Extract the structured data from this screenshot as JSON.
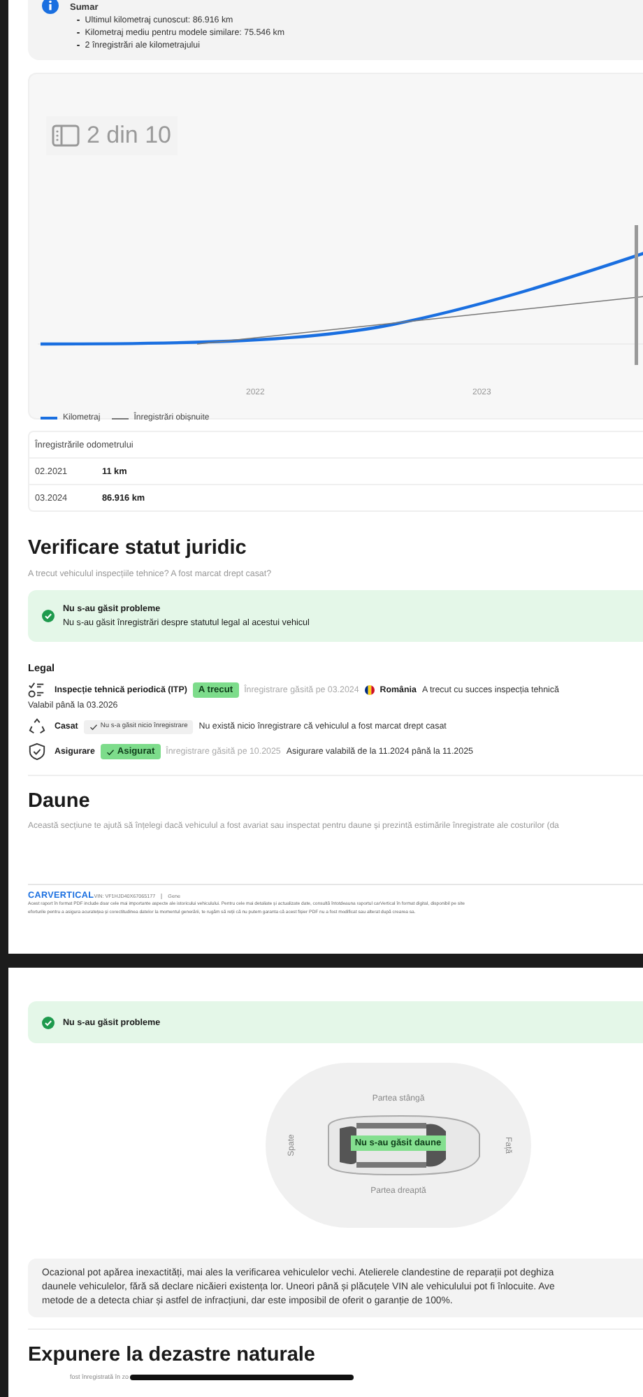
{
  "summary": {
    "title": "Sumar",
    "items": [
      "Ultimul kilometraj cunoscut: 86.916 km",
      "Kilometraj mediu pentru modele similare: 75.546 km",
      "2 înregistrări ale kilometrajului"
    ]
  },
  "mileage_chart": {
    "gallery_counter": "2 din 10",
    "xticks": [
      "2022",
      "2023"
    ],
    "legend": [
      {
        "label": "Kilometraj",
        "color": "#1a6fe0"
      },
      {
        "label": "Înregistrări obișnuite",
        "color": "#777777"
      }
    ]
  },
  "odometer": {
    "title": "Înregistrările odometrului",
    "rows": [
      {
        "date": "02.2021",
        "value": "11 km"
      },
      {
        "date": "03.2024",
        "value": "86.916 km"
      }
    ]
  },
  "legal_status": {
    "title": "Verificare statut juridic",
    "subtitle": "A trecut vehiculul inspecțiile tehnice? A fost marcat drept casat?",
    "alert": {
      "kind": "success",
      "title": "Nu s-au găsit probleme",
      "text": "Nu s-au găsit înregistrări despre statutul legal al acestui vehicul"
    },
    "section": "Legal",
    "records": [
      {
        "kind": "inspection",
        "label": "Inspecție tehnică periodică (ITP)",
        "badge": "A trecut",
        "color": "#7ddc8b",
        "checkmark": false,
        "found": "Înregistrare găsită pe 03.2024",
        "country": "România",
        "note": "A trecut cu succes inspecția tehnică",
        "validity": "Valabil până la 03.2026"
      },
      {
        "kind": "scrapped",
        "label": "Casat",
        "badge": "Nu s-a găsit nicio înregistrare",
        "color": "#f0f0f0",
        "checkmark": true,
        "note": "Nu există nicio înregistrare că vehiculul a fost marcat drept casat"
      },
      {
        "kind": "insurance",
        "label": "Asigurare",
        "badge": "Asigurat",
        "color": "#7ddc8b",
        "checkmark": true,
        "found": "Înregistrare găsită pe 10.2025",
        "note": "Asigurare valabilă de la 11.2024 până la 11.2025"
      }
    ]
  },
  "damage": {
    "title": "Daune",
    "subtitle": "Această secțiune te ajută să înțelegi dacă vehiculul a fost avariat sau inspectat pentru daune și prezintă estimările înregistrate ale costurilor (da"
  },
  "footer": {
    "logo": "CARVERTICAL",
    "vin": "VIN: VF1HJD40X67065177",
    "cut": "Gene",
    "disclaimer": [
      "Acest raport în format PDF include doar cele mai importante aspecte ale istoricului vehiculului. Pentru cele mai detaliate și actualizate date, consultă întotdeauna raportul carVertical în format digital, disponibil pe site",
      "eforturile pentru a asigura acuratețea și corectitudinea datelor la momentul generării, te rugăm să reții că nu putem garanta că acest fișier PDF nu a fost modificat sau alterat după crearea sa."
    ]
  },
  "damage_page": {
    "alert": {
      "kind": "success",
      "title": "Nu s-au găsit probleme"
    },
    "diagram": {
      "top": "Partea stângă",
      "bottom": "Partea dreaptă",
      "left": "Spate",
      "right": "Față",
      "badge": "Nu s-au găsit daune"
    },
    "note": [
      "Ocazional pot apărea inexactități, mai ales la verificarea vehiculelor vechi. Atelierele clandestine de reparații pot deghiza",
      "daunele vehiculelor, fără să declare nicăieri existența lor. Uneori până și plăcuțele VIN ale vehiculului pot fi înlocuite. Ave",
      "metode de a detecta chiar și astfel de infracțiuni, dar este imposibil de oferit o garanție de 100%."
    ]
  },
  "natural_disasters": {
    "title": "Expunere la dezastre naturale",
    "text": "fost înregistrată în zo"
  }
}
